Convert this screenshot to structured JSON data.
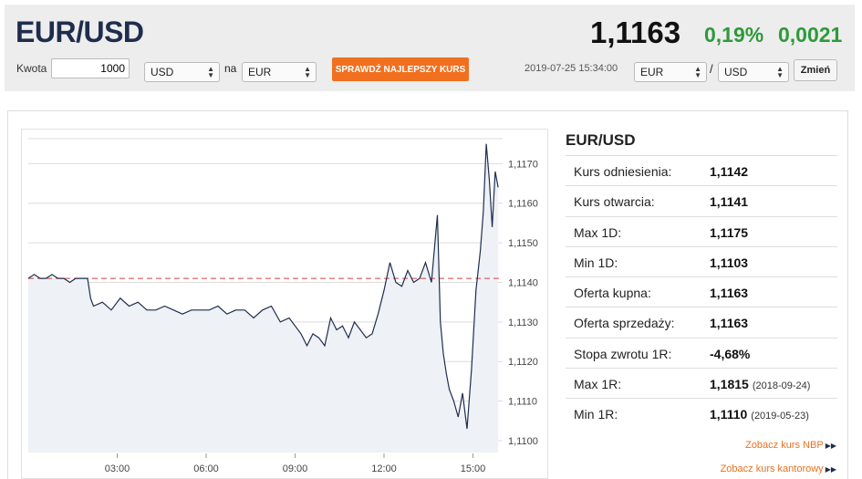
{
  "header": {
    "pair": "EUR/USD",
    "rate": "1,1163",
    "change_pct": "0,19%",
    "change_abs": "0,0021",
    "colors": {
      "change": "#2e9a3a",
      "brand": "#1f2d4d",
      "accent": "#f07020"
    }
  },
  "converter": {
    "amount_label": "Kwota",
    "amount_value": "1000",
    "from_currency": "USD",
    "to_label": "na",
    "to_currency": "EUR",
    "best_rate_button": "SPRAWDŹ NAJLEPSZY KURS",
    "timestamp": "2019-07-25 15:34:00",
    "pair_from": "EUR",
    "pair_to": "USD",
    "change_button": "Zmień"
  },
  "info": {
    "title": "EUR/USD",
    "rows": [
      {
        "label": "Kurs odniesienia:",
        "value": "1,1142"
      },
      {
        "label": "Kurs otwarcia:",
        "value": "1,1141"
      },
      {
        "label": "Max 1D:",
        "value": "1,1175"
      },
      {
        "label": "Min 1D:",
        "value": "1,1103"
      },
      {
        "label": "Oferta kupna:",
        "value": "1,1163"
      },
      {
        "label": "Oferta sprzedaży:",
        "value": "1,1163"
      },
      {
        "label": "Stopa zwrotu 1R:",
        "value": "-4,68%"
      },
      {
        "label": "Max 1R:",
        "value": "1,1815",
        "date": "(2018-09-24)"
      },
      {
        "label": "Min 1R:",
        "value": "1,1110",
        "date": "(2019-05-23)"
      }
    ],
    "links": [
      "Zobacz kurs NBP",
      "Zobacz kurs kantorowy"
    ]
  },
  "chart_data": {
    "type": "line",
    "x_ticks": [
      "03:00",
      "06:00",
      "09:00",
      "12:00",
      "15:00"
    ],
    "y_ticks": [
      "1,1100",
      "1,1110",
      "1,1120",
      "1,1130",
      "1,1140",
      "1,1150",
      "1,1160",
      "1,1170"
    ],
    "ylim": [
      1.1097,
      1.1177
    ],
    "reference_line": 1.1141,
    "grid": true,
    "series": [
      {
        "x": [
          0,
          0.2,
          0.4,
          0.6,
          0.8,
          1.0,
          1.2,
          1.4,
          1.6,
          1.8,
          2.0,
          2.1,
          2.2,
          2.5,
          2.8,
          3.1,
          3.4,
          3.7,
          4.0,
          4.3,
          4.6,
          4.9,
          5.2,
          5.5,
          5.8,
          6.1,
          6.4,
          6.7,
          7.0,
          7.3,
          7.6,
          7.9,
          8.2,
          8.5,
          8.8,
          9.0,
          9.2,
          9.4,
          9.6,
          9.8,
          10.0,
          10.2,
          10.4,
          10.6,
          10.8,
          11.0,
          11.2,
          11.4,
          11.6,
          11.8,
          12.0,
          12.2,
          12.4,
          12.6,
          12.8,
          13.0,
          13.2,
          13.4,
          13.6,
          13.8,
          13.9,
          14.0,
          14.1,
          14.2,
          14.35,
          14.5,
          14.65,
          14.8,
          14.95,
          15.1,
          15.25,
          15.35,
          15.45,
          15.55,
          15.65,
          15.75,
          15.85
        ],
        "y": [
          1.1141,
          1.1142,
          1.1141,
          1.1141,
          1.1142,
          1.1141,
          1.1141,
          1.114,
          1.1141,
          1.1141,
          1.1141,
          1.1136,
          1.1134,
          1.1135,
          1.1133,
          1.1136,
          1.1134,
          1.1135,
          1.1133,
          1.1133,
          1.1134,
          1.1133,
          1.1132,
          1.1133,
          1.1133,
          1.1133,
          1.1134,
          1.1132,
          1.1133,
          1.1133,
          1.1131,
          1.1133,
          1.1134,
          1.113,
          1.1131,
          1.1129,
          1.1127,
          1.1124,
          1.1127,
          1.1126,
          1.1124,
          1.1131,
          1.1128,
          1.1129,
          1.1126,
          1.113,
          1.1128,
          1.1126,
          1.1127,
          1.1132,
          1.1138,
          1.1145,
          1.114,
          1.1139,
          1.1143,
          1.114,
          1.1141,
          1.1145,
          1.114,
          1.1157,
          1.113,
          1.1122,
          1.1117,
          1.1113,
          1.111,
          1.1106,
          1.1112,
          1.1103,
          1.1118,
          1.1138,
          1.1148,
          1.1158,
          1.1175,
          1.1166,
          1.1154,
          1.1168,
          1.1164
        ]
      }
    ]
  }
}
